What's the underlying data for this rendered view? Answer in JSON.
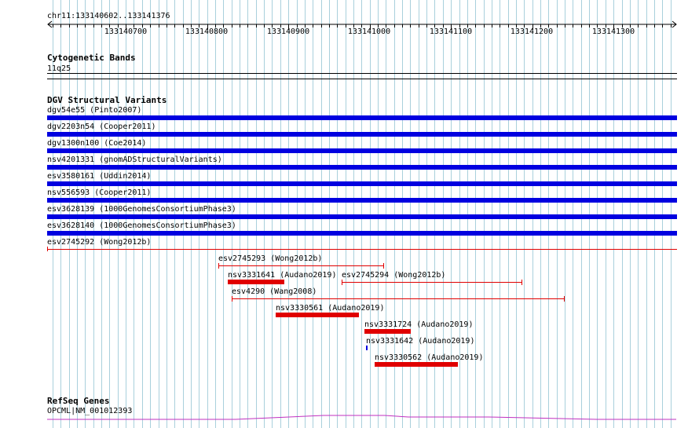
{
  "colors": {
    "grid": "#a9d0dc",
    "dgv_blue": "#0000e0",
    "dgv_red": "#e00000",
    "refseq": "#c030c0"
  },
  "ruler": {
    "location": "chr11:133140602..133141376",
    "ticks": [
      "133140700",
      "133140800",
      "133140900",
      "133141000",
      "133141100",
      "133141200",
      "133141300"
    ]
  },
  "cytoband": {
    "title": "Cytogenetic Bands",
    "band": "11q25"
  },
  "dgv": {
    "title": "DGV Structural Variants",
    "full_rows": [
      {
        "label": "dgv54e55 (Pinto2007)",
        "color": "blue"
      },
      {
        "label": "dgv2203n54 (Cooper2011)",
        "color": "blue"
      },
      {
        "label": "dgv1300n100 (Coe2014)",
        "color": "blue"
      },
      {
        "label": "nsv4201331 (gnomADStructuralVariants)",
        "color": "blue"
      },
      {
        "label": "esv3580161 (Uddin2014)",
        "color": "blue"
      },
      {
        "label": "nsv556593 (Cooper2011)",
        "color": "blue"
      },
      {
        "label": "esv3628139 (1000GenomesConsortiumPhase3)",
        "color": "blue"
      },
      {
        "label": "esv3628140 (1000GenomesConsortiumPhase3)",
        "color": "blue"
      },
      {
        "label": "esv2745292 (Wong2012b)",
        "color": "red-thin"
      }
    ],
    "features": [
      {
        "label": "esv2745293 (Wong2012b)",
        "style": "red-thin"
      },
      {
        "label": "nsv3331641 (Audano2019)",
        "style": "red-thick"
      },
      {
        "label": "esv2745294 (Wong2012b)",
        "style": "red-thin"
      },
      {
        "label": "esv4290 (Wang2008)",
        "style": "red-thin"
      },
      {
        "label": "nsv3330561 (Audano2019)",
        "style": "red-thick"
      },
      {
        "label": "nsv3331724 (Audano2019)",
        "style": "red-thick"
      },
      {
        "label": "nsv3331642 (Audano2019)",
        "style": "blue-tick"
      },
      {
        "label": "nsv3330562 (Audano2019)",
        "style": "red-thick"
      }
    ]
  },
  "refseq": {
    "title": "RefSeq Genes",
    "gene": "OPCML|NM_001012393"
  }
}
